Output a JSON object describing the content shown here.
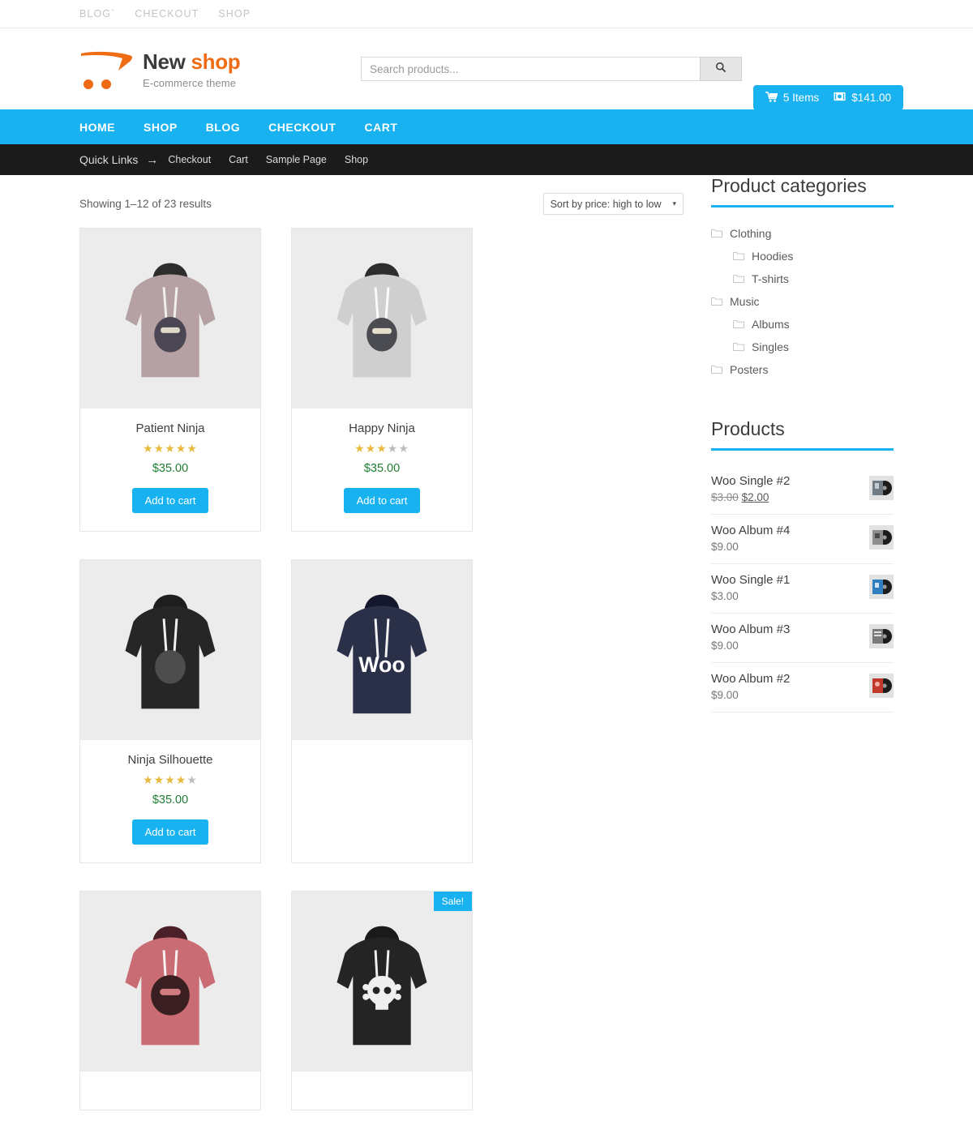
{
  "topbar": {
    "links": [
      {
        "label": "BLOG`"
      },
      {
        "label": "CHECKOUT"
      },
      {
        "label": "SHOP"
      }
    ]
  },
  "header": {
    "logo": {
      "title_part1": "New ",
      "title_part2": "shop",
      "tagline": "E-commerce theme",
      "mark": "shopping-cart-swoosh"
    },
    "search": {
      "placeholder": "Search products...",
      "value": "",
      "button_icon": "search-icon"
    },
    "cart": {
      "items_label": "5 Items",
      "total_label": "$141.00",
      "cart_icon": "shopping-cart-icon",
      "money_icon": "money-icon"
    }
  },
  "mainnav": {
    "items": [
      {
        "label": "HOME"
      },
      {
        "label": "SHOP"
      },
      {
        "label": "BLOG"
      },
      {
        "label": "CHECKOUT"
      },
      {
        "label": "CART"
      }
    ]
  },
  "quicklinks": {
    "label": "Quick Links",
    "arrow": "→",
    "items": [
      {
        "label": "Checkout"
      },
      {
        "label": "Cart"
      },
      {
        "label": "Sample Page"
      },
      {
        "label": "Shop"
      }
    ]
  },
  "shop": {
    "result_count": "Showing 1–12 of 23 results",
    "sort": {
      "selected": "Sort by price: high to low",
      "caret": "▾",
      "options": [
        "Sort by price: high to low"
      ]
    },
    "sale_badge": "Sale!",
    "add_to_cart_label": "Add to cart",
    "products": [
      {
        "name": "Patient Ninja",
        "price": "$35.00",
        "rating": 5,
        "on_sale": false,
        "image": "hoodie-mauve-ninja-character"
      },
      {
        "name": "Happy Ninja",
        "price": "$35.00",
        "rating": 3,
        "on_sale": false,
        "image": "hoodie-lightgray-ninja-character"
      },
      {
        "name": "Ninja Silhouette",
        "price": "$35.00",
        "rating": 4,
        "on_sale": false,
        "image": "hoodie-black-ninja-silhouette"
      },
      {
        "name": "",
        "price": "",
        "rating": 0,
        "on_sale": false,
        "image": "hoodie-navy-woo-logo"
      },
      {
        "name": "",
        "price": "",
        "rating": 0,
        "on_sale": false,
        "image": "hoodie-red-ninja-face"
      },
      {
        "name": "",
        "price": "",
        "rating": 0,
        "on_sale": true,
        "image": "hoodie-black-skull-crossbones"
      }
    ]
  },
  "sidebar": {
    "categories_widget": {
      "title": "Product categories",
      "items": [
        {
          "label": "Clothing",
          "level": 0,
          "icon": "folder-icon"
        },
        {
          "label": "Hoodies",
          "level": 1,
          "icon": "folder-icon"
        },
        {
          "label": "T-shirts",
          "level": 1,
          "icon": "folder-icon"
        },
        {
          "label": "Music",
          "level": 0,
          "icon": "folder-icon"
        },
        {
          "label": "Albums",
          "level": 1,
          "icon": "folder-icon"
        },
        {
          "label": "Singles",
          "level": 1,
          "icon": "folder-icon"
        },
        {
          "label": "Posters",
          "level": 0,
          "icon": "folder-icon"
        }
      ]
    },
    "products_widget": {
      "title": "Products",
      "items": [
        {
          "name": "Woo Single #2",
          "regular_price": "$3.00",
          "sale_price": "$2.00",
          "on_sale": true,
          "thumb_color": "#6f7b85",
          "thumb": "vinyl-record-gray"
        },
        {
          "name": "Woo Album #4",
          "regular_price": "$9.00",
          "sale_price": "",
          "on_sale": false,
          "thumb_color": "#8e8e8e",
          "thumb": "vinyl-record-gray"
        },
        {
          "name": "Woo Single #1",
          "regular_price": "$3.00",
          "sale_price": "",
          "on_sale": false,
          "thumb_color": "#2f7fc0",
          "thumb": "vinyl-record-blue"
        },
        {
          "name": "Woo Album #3",
          "regular_price": "$9.00",
          "sale_price": "",
          "on_sale": false,
          "thumb_color": "#7a7a7a",
          "thumb": "vinyl-record-gray"
        },
        {
          "name": "Woo Album #2",
          "regular_price": "$9.00",
          "sale_price": "",
          "on_sale": false,
          "thumb_color": "#c0392b",
          "thumb": "vinyl-record-red"
        }
      ]
    }
  },
  "colors": {
    "accent": "#18b2f0",
    "brand_orange": "#ef6c15",
    "price_green": "#1e7d32",
    "dark_bar": "#1b1b1b",
    "star_on": "#e8b93c",
    "star_off": "#bdbdbd"
  }
}
